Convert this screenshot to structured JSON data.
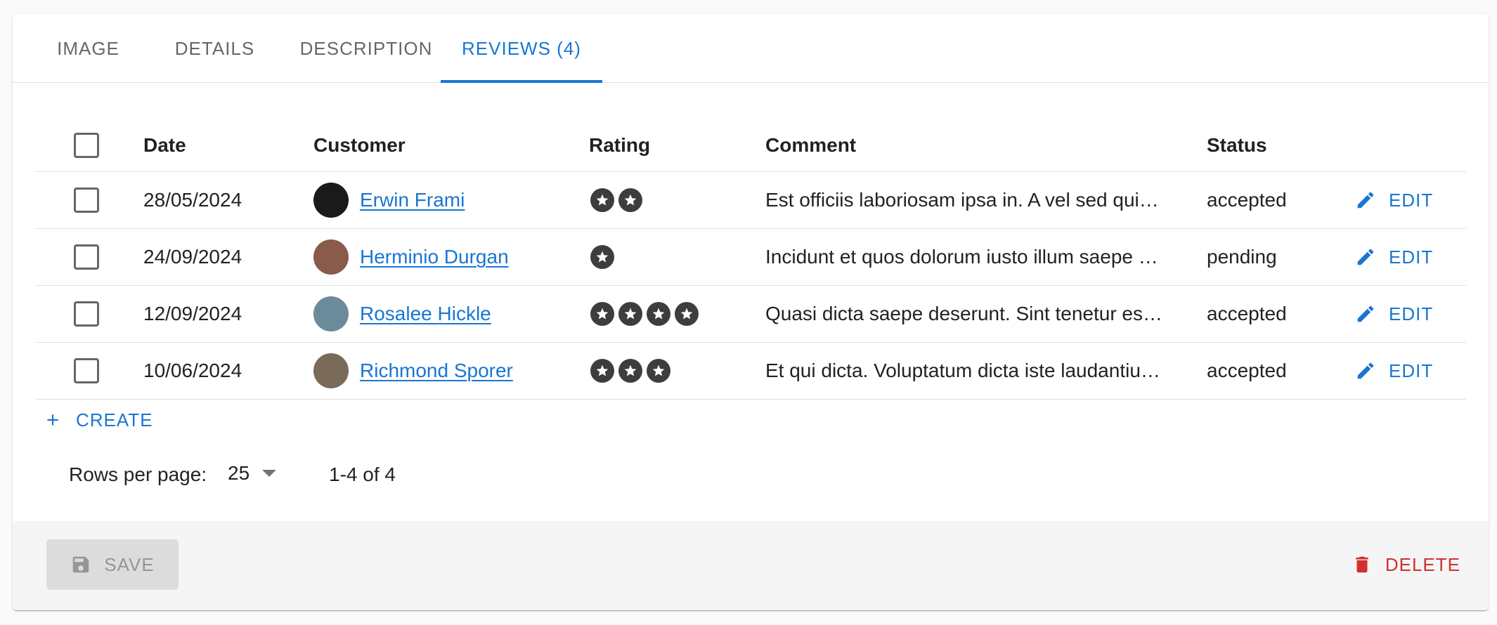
{
  "tabs": [
    {
      "label": "IMAGE",
      "active": false
    },
    {
      "label": "DETAILS",
      "active": false
    },
    {
      "label": "DESCRIPTION",
      "active": false
    },
    {
      "label": "REVIEWS (4)",
      "active": true
    }
  ],
  "table": {
    "headers": {
      "date": "Date",
      "customer": "Customer",
      "rating": "Rating",
      "comment": "Comment",
      "status": "Status"
    },
    "rows": [
      {
        "date": "28/05/2024",
        "customer": "Erwin Frami",
        "rating": 2,
        "comment": "Est officiis laboriosam ipsa in. A vel sed quibusdam",
        "status": "accepted",
        "edit_label": "EDIT",
        "avatar_color": "#1a1a1a"
      },
      {
        "date": "24/09/2024",
        "customer": "Herminio Durgan",
        "rating": 1,
        "comment": "Incidunt et quos dolorum iusto illum saepe dolorem",
        "status": "pending",
        "edit_label": "EDIT",
        "avatar_color": "#8a5a4a"
      },
      {
        "date": "12/09/2024",
        "customer": "Rosalee Hickle",
        "rating": 4,
        "comment": "Quasi dicta saepe deserunt. Sint tenetur est nobis",
        "status": "accepted",
        "edit_label": "EDIT",
        "avatar_color": "#6b8a9a"
      },
      {
        "date": "10/06/2024",
        "customer": "Richmond Sporer",
        "rating": 3,
        "comment": "Et qui dicta. Voluptatum dicta iste laudantium quo",
        "status": "accepted",
        "edit_label": "EDIT",
        "avatar_color": "#7a6a5a"
      }
    ]
  },
  "create_label": "CREATE",
  "pagination": {
    "rows_per_page_label": "Rows per page:",
    "rows_per_page_value": "25",
    "range": "1-4 of 4"
  },
  "toolbar": {
    "save_label": "SAVE",
    "delete_label": "DELETE"
  },
  "colors": {
    "accent": "#1976d2",
    "danger": "#d32f2f"
  }
}
